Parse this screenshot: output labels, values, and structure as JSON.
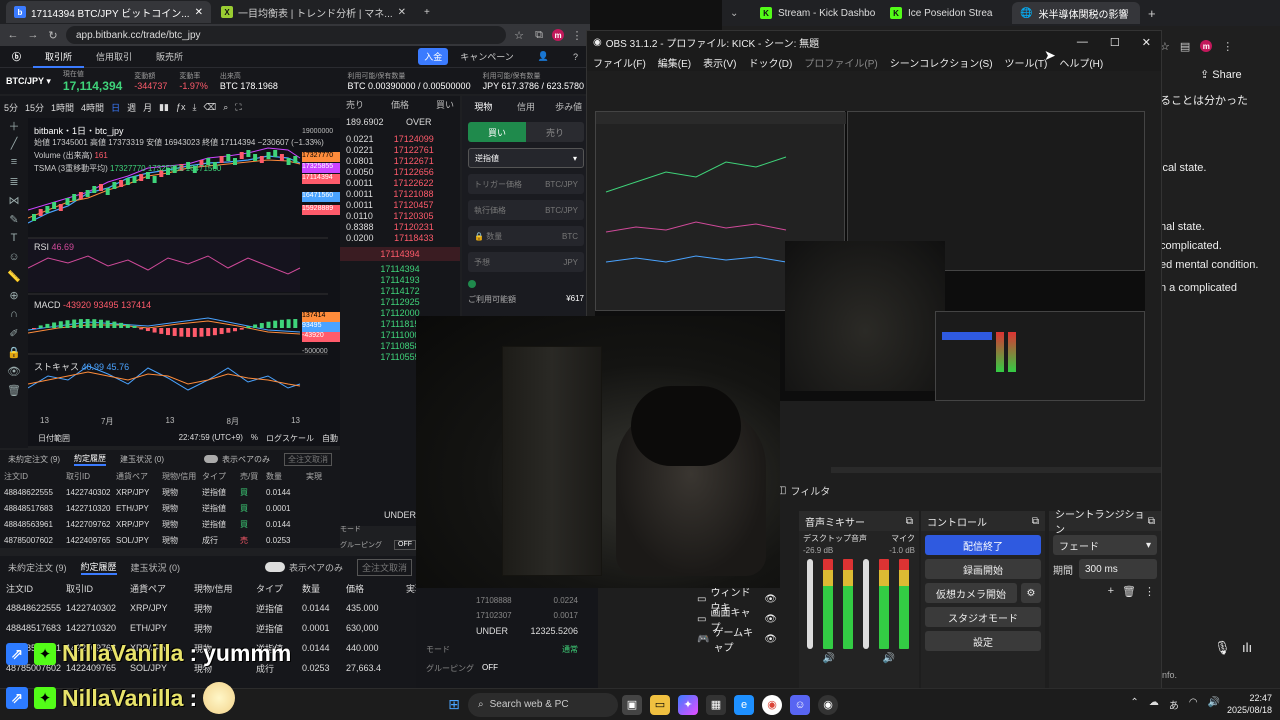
{
  "left_browser": {
    "tabs": [
      {
        "title": "17114394 BTC/JPY ビットコイン..."
      },
      {
        "title": "一目均衡表 | トレンド分析 | マネ..."
      }
    ],
    "url": "app.bitbank.cc/trade/btc_jpy",
    "nav": [
      "取引所",
      "信用取引",
      "販売所"
    ],
    "deposit": "入金",
    "campaign": "キャンペーン",
    "pair": "BTC/JPY",
    "last_price_label": "現在値",
    "last_price": "17,114,394",
    "change_label": "変動額",
    "change": "-344737",
    "change_rate_label": "変動率",
    "change_rate": "-1.97%",
    "high_label": "出来高",
    "volume": "BTC 178.1968",
    "avail_label": "利用可能/保有数量",
    "btc_avail": "BTC 0.00390000 / 0.00500000",
    "jpy_avail": "JPY 617.3786 / 623.5780",
    "toolbar": [
      "5分",
      "15分",
      "1時間",
      "4時間",
      "日",
      "週",
      "月"
    ],
    "chart_title": "bitbank・1日・btc_jpy",
    "ohlc": "始値 17345001 高値 17373319 安値 16943023 終値 17114394 −230607 (−1.33%)",
    "volume_label": "Volume (出来高)",
    "volume_val": "161",
    "tsma_label": "TSMA (3重移動平均)",
    "tsma_vals": "17327770 17325855 16471560",
    "price_axis": [
      "19000000",
      "17327770",
      "17325855",
      "17114394",
      "16471560",
      "15928889"
    ],
    "rsi_label": "RSI",
    "rsi_val": "46.69",
    "macd_label": "MACD",
    "macd_vals": "-43920 93495 137414",
    "macd_axis": [
      "137414",
      "93495",
      "-43920",
      "-500000"
    ],
    "stoch_label": "ストキャス",
    "stoch_vals": "40.99 45.76",
    "date_axis": [
      "13",
      "7月",
      "13",
      "8月",
      "13"
    ],
    "range_label": "日付範囲",
    "chart_time": "22:47:59 (UTC+9)",
    "log_scale": "ログスケール",
    "auto": "自動"
  },
  "orderbook": {
    "headers": [
      "売り",
      "価格",
      "買い"
    ],
    "over_label": "OVER",
    "over_value": "189.6902",
    "asks": [
      {
        "qty": "0.0221",
        "price": "17124099"
      },
      {
        "qty": "0.0221",
        "price": "17122761"
      },
      {
        "qty": "0.0801",
        "price": "17122671"
      },
      {
        "qty": "0.0050",
        "price": "17122656"
      },
      {
        "qty": "0.0011",
        "price": "17122622"
      },
      {
        "qty": "0.0011",
        "price": "17121088"
      },
      {
        "qty": "0.0011",
        "price": "17120457"
      },
      {
        "qty": "0.0110",
        "price": "17120305"
      },
      {
        "qty": "0.8388",
        "price": "17120231"
      },
      {
        "qty": "0.0200",
        "price": "17118433"
      }
    ],
    "mid": "17114394",
    "bids": [
      "17114394",
      "17114193",
      "17114172",
      "17112925",
      "17112000",
      "17111815",
      "17111000",
      "17110858",
      "17110555"
    ],
    "under_label": "UNDER"
  },
  "trade_panel": {
    "tabs": [
      "現物",
      "信用",
      "歩み値"
    ],
    "buy": "買い",
    "sell": "売り",
    "order_type": "逆指値",
    "trigger": "トリガー価格",
    "trigger_unit": "BTC/JPY",
    "exec_price": "執行価格",
    "exec_unit": "BTC/JPY",
    "qty": "数量",
    "qty_unit": "BTC",
    "estimate": "予想",
    "estimate_unit": "JPY",
    "avail": "ご利用可能額",
    "avail_val": "¥617",
    "mode": "モード",
    "grouping": "グルーピング",
    "grouping_val": "OFF"
  },
  "orders": {
    "tabs": [
      "未約定注文 (9)",
      "約定履歴",
      "建玉状況 (0)"
    ],
    "pair_only": "表示ペアのみ",
    "cancel_all": "全注文取消",
    "headers": [
      "注文ID",
      "取引ID",
      "通貨ペア",
      "現物/信用",
      "タイプ",
      "売/買",
      "数量",
      "価格",
      "実現"
    ],
    "rows": [
      [
        "48848622555",
        "1422740302",
        "XRP/JPY",
        "現物",
        "逆指値",
        "買",
        "0.0144",
        "435.000"
      ],
      [
        "48848517683",
        "1422710320",
        "ETH/JPY",
        "現物",
        "逆指値",
        "買",
        "0.0001",
        "630,000"
      ],
      [
        "48848563961",
        "1422709762",
        "XRP/JPY",
        "現物",
        "逆指値",
        "買",
        "0.0144",
        "440.000"
      ],
      [
        "48785007602",
        "1422409765",
        "SOL/JPY",
        "現物",
        "成行",
        "売",
        "0.0253",
        "27,663.4"
      ]
    ]
  },
  "obs": {
    "title": "OBS 31.1.2 - プロファイル: KICK - シーン: 無題",
    "menu": [
      "ファイル(F)",
      "編集(E)",
      "表示(V)",
      "ドック(D)",
      "プロファイル(P)",
      "シーンコレクション(S)",
      "ツール(T)",
      "ヘルプ(H)"
    ],
    "filters": "フィルタ",
    "audio_mixer": "音声ミキサー",
    "desktop_audio": "デスクトップ音声",
    "desktop_db": "-26.9 dB",
    "mic": "マイク",
    "mic_db": "-1.0 dB",
    "controls": "コントロール",
    "stop_stream": "配信終了",
    "start_record": "録画開始",
    "start_vcam": "仮想カメラ開始",
    "studio_mode": "スタジオモード",
    "settings": "設定",
    "transitions": "シーントランジション",
    "fade": "フェード",
    "duration_label": "期間",
    "duration": "300 ms",
    "sources": [
      "ウィンドウキ",
      "画面キャプ",
      "ゲームキャプ"
    ]
  },
  "right_browser": {
    "tabs": [
      {
        "title": "Stream - Kick Dashbo"
      },
      {
        "title": "Ice Poseidon Strea"
      },
      {
        "title": "米半導体関税の影響"
      }
    ],
    "share": "Share",
    "chat": [
      "ることは分かった",
      "ical state.",
      "nal state.",
      "complicated.",
      "ed mental condition.",
      "n a complicated",
      "info."
    ]
  },
  "chat_overlay": [
    {
      "user": "NillaVanilla",
      "message": "yummm"
    },
    {
      "user": "NillaVanilla",
      "message": ""
    }
  ],
  "taskbar": {
    "search": "Search web & PC",
    "time": "22:47",
    "date": "2025/08/18"
  },
  "webcam_overlay": {
    "qty1": "17108888",
    "v1": "0.0224",
    "qty2": "17102307",
    "v2": "0.0017",
    "under": "UNDER",
    "under_val": "12325.5206",
    "mode": "モード",
    "mode_val": "通常",
    "grouping": "グルーピング",
    "grouping_val": "OFF"
  }
}
